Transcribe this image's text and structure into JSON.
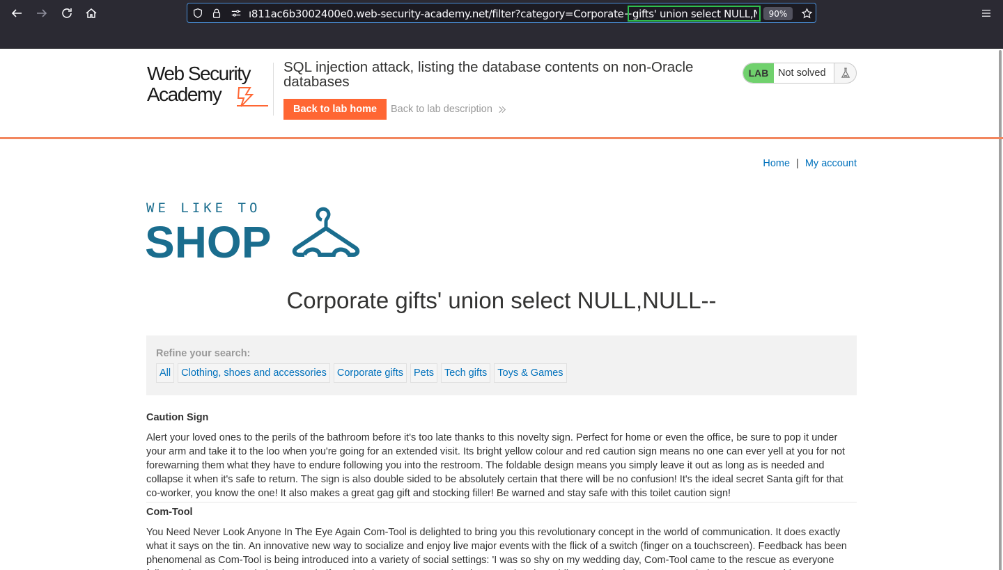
{
  "browser": {
    "url": "ı811ac6b3002400e0.web-security-academy.net/filter?category=Corporate+gifts' union select NULL,NULL--",
    "zoom": "90%",
    "icons": {
      "back": "back-arrow-icon",
      "forward": "forward-arrow-icon",
      "reload": "reload-icon",
      "home": "home-icon",
      "shield": "shield-icon",
      "lock": "lock-icon",
      "permissions": "permissions-icon",
      "bookmark": "star-icon",
      "menu": "hamburger-menu-icon"
    }
  },
  "lab": {
    "logo_line1": "Web Security",
    "logo_line2": "Academy",
    "title": "SQL injection attack, listing the database contents on non-Oracle databases",
    "back_home": "Back to lab home",
    "back_description": "Back to lab description",
    "status_tag": "LAB",
    "status": "Not solved",
    "colors": {
      "accent": "#ff6633",
      "lab_green": "#70d16d",
      "link": "#0071bc"
    }
  },
  "nav": {
    "home": "Home",
    "separator": "|",
    "my_account": "My account"
  },
  "shop_logo": {
    "line1": "WE LIKE TO",
    "line2": "SHOP",
    "color": "#1a6d8e"
  },
  "heading": "Corporate gifts' union select NULL,NULL--",
  "refine": {
    "label": "Refine your search:",
    "filters": [
      "All",
      "Clothing, shoes and accessories",
      "Corporate gifts",
      "Pets",
      "Tech gifts",
      "Toys & Games"
    ]
  },
  "products": [
    {
      "name": "Caution Sign",
      "description": "Alert your loved ones to the perils of the bathroom before it's too late thanks to this novelty sign. Perfect for home or even the office, be sure to pop it under your arm and take it to the loo when you're going for an extended visit. Its bright yellow colour and red caution sign means no one can ever yell at you for not forewarning them what they have to endure following you into the restroom. The foldable design means you simply leave it out as long as is needed and collapse it when it's safe to return. The sign is also double sided to be absolutely certain that there will be no confusion! It's the ideal secret Santa gift for that co-worker, you know the one! It also makes a great gag gift and stocking filler! Be warned and stay safe with this toilet caution sign!"
    },
    {
      "name": "Com-Tool",
      "description": "You Need Never Look Anyone In The Eye Again Com-Tool is delighted to bring you this revolutionary concept in the world of communication. It does exactly what it says on the tin. An innovative new way to socialize and enjoy live major events with the flick of a switch (finger on a touchscreen). Feedback has been phenomenal as Com-Tool is being introduced into a variety of social settings: 'I was so shy on my wedding day, Com-Tool came to the rescue as everyone followed the service on their Com-Tool gifts! It has been more engaging than any church wedding service I have ever attended. What more could you want to enhance your social life?"
    }
  ]
}
